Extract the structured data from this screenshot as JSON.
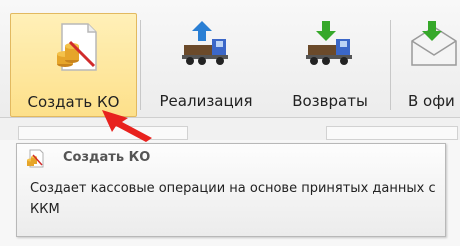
{
  "toolbar": {
    "buttons": [
      {
        "label": "Создать КО",
        "icon": "create-cash-operation-icon"
      },
      {
        "label": "Реализация",
        "icon": "sales-truck-icon"
      },
      {
        "label": "Возвраты",
        "icon": "returns-truck-icon"
      },
      {
        "label": "В офи",
        "icon": "send-to-office-envelope-icon"
      }
    ]
  },
  "tooltip": {
    "title": "Создать КО",
    "body": "Создает кассовые операции на основе принятых данных с ККМ",
    "icon": "create-cash-operation-icon"
  },
  "colors": {
    "selected_button": "#fde08a",
    "arrow": "#e8221e",
    "up_arrow": "#2a7fd4",
    "down_arrow": "#36a82a"
  }
}
